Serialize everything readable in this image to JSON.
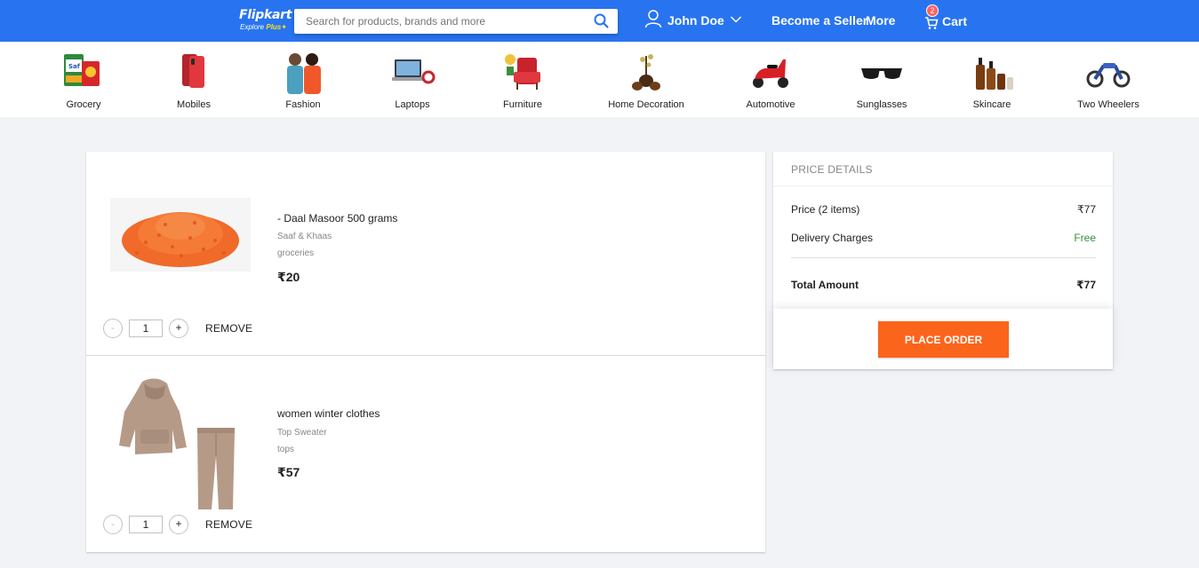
{
  "header": {
    "logo_main": "Flipkart",
    "logo_sub_explore": "Explore",
    "logo_sub_plus": "Plus",
    "search_placeholder": "Search for products, brands and more",
    "search_value": "",
    "user_name": "John Doe",
    "become_seller": "Become a Seller",
    "more": "More",
    "cart_label": "Cart",
    "cart_count": "2",
    "colors": {
      "brand": "#2874f0",
      "badge": "#ff6161",
      "logo_accent": "#ffe11b"
    }
  },
  "categories": [
    {
      "label": "Grocery",
      "icon": "grocery-icon"
    },
    {
      "label": "Mobiles",
      "icon": "mobile-phone-icon"
    },
    {
      "label": "Fashion",
      "icon": "fashion-icon"
    },
    {
      "label": "Laptops",
      "icon": "laptop-icon"
    },
    {
      "label": "Furniture",
      "icon": "furniture-icon"
    },
    {
      "label": "Home Decoration",
      "icon": "home-decor-icon"
    },
    {
      "label": "Automotive",
      "icon": "scooter-icon"
    },
    {
      "label": "Sunglasses",
      "icon": "sunglasses-icon"
    },
    {
      "label": "Skincare",
      "icon": "skincare-icon"
    },
    {
      "label": "Two Wheelers",
      "icon": "motorbike-icon"
    }
  ],
  "cart_items": [
    {
      "title": "- Daal Masoor 500 grams",
      "seller": "Saaf & Khaas",
      "category": "groceries",
      "price": "₹20",
      "quantity": "1",
      "minus_label": "-",
      "plus_label": "+",
      "remove_label": "REMOVE",
      "image": "lentils-image"
    },
    {
      "title": "women winter clothes",
      "seller": "Top Sweater",
      "category": "tops",
      "price": "₹57",
      "quantity": "1",
      "minus_label": "-",
      "plus_label": "+",
      "remove_label": "REMOVE",
      "image": "tracksuit-image"
    }
  ],
  "price_details": {
    "heading": "PRICE DETAILS",
    "price_label": "Price (2 items)",
    "price_value": "₹77",
    "delivery_label": "Delivery Charges",
    "delivery_value": "Free",
    "total_label": "Total Amount",
    "total_value": "₹77",
    "place_order": "PLACE ORDER",
    "colors": {
      "free": "#388e3c",
      "order_button": "#fb641b"
    }
  }
}
